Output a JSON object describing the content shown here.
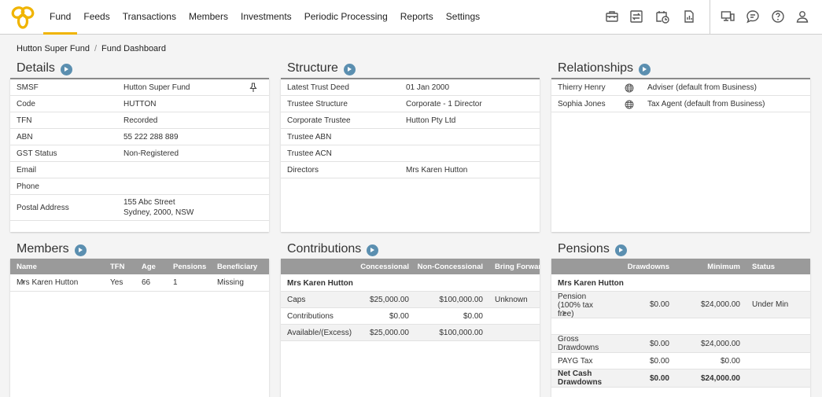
{
  "nav": {
    "items": [
      "Fund",
      "Feeds",
      "Transactions",
      "Members",
      "Investments",
      "Periodic Processing",
      "Reports",
      "Settings"
    ],
    "active": "Fund"
  },
  "icons": [
    "briefcase-icon",
    "transfer-icon",
    "calendar-clock-icon",
    "report-doc-icon",
    "devices-icon",
    "chat-icon",
    "help-icon",
    "user-icon"
  ],
  "colors": {
    "accent": "#f0b400",
    "go_button": "#5b8fb0",
    "table_header": "#9a9a9a"
  },
  "breadcrumb": {
    "root": "Hutton Super Fund",
    "sep": "/",
    "current": "Fund Dashboard"
  },
  "details": {
    "title": "Details",
    "rows": [
      {
        "k": "SMSF",
        "v": "Hutton Super Fund"
      },
      {
        "k": "Code",
        "v": "HUTTON"
      },
      {
        "k": "TFN",
        "v": "Recorded"
      },
      {
        "k": "ABN",
        "v": "55 222 288 889"
      },
      {
        "k": "GST Status",
        "v": "Non-Registered"
      },
      {
        "k": "Email",
        "v": ""
      },
      {
        "k": "Phone",
        "v": ""
      }
    ],
    "postal": {
      "k": "Postal Address",
      "line1": "155 Abc Street",
      "line2": "Sydney, 2000, NSW"
    }
  },
  "structure": {
    "title": "Structure",
    "rows": [
      {
        "k": "Latest Trust Deed",
        "v": "01 Jan 2000"
      },
      {
        "k": "Trustee Structure",
        "v": "Corporate - 1 Director"
      },
      {
        "k": "Corporate Trustee",
        "v": "Hutton Pty Ltd"
      },
      {
        "k": "Trustee ABN",
        "v": ""
      },
      {
        "k": "Trustee ACN",
        "v": ""
      },
      {
        "k": "Directors",
        "v": "Mrs Karen Hutton"
      }
    ]
  },
  "relationships": {
    "title": "Relationships",
    "rows": [
      {
        "name": "Thierry Henry",
        "role": "Adviser (default from Business)"
      },
      {
        "name": "Sophia Jones",
        "role": "Tax Agent (default from Business)"
      }
    ]
  },
  "members": {
    "title": "Members",
    "headers": [
      "Name",
      "TFN",
      "Age",
      "Pensions",
      "Beneficiary"
    ],
    "rows": [
      {
        "name": "Mrs Karen Hutton",
        "tfn": "Yes",
        "age": "66",
        "pensions": "1",
        "beneficiary": "Missing"
      }
    ]
  },
  "contributions": {
    "title": "Contributions",
    "headers": [
      "Concessional",
      "Non-Concessional",
      "Bring Forward"
    ],
    "member": "Mrs Karen Hutton",
    "rows": [
      {
        "label": "Caps",
        "c": "$25,000.00",
        "nc": "$100,000.00",
        "bf": "Unknown"
      },
      {
        "label": "Contributions",
        "c": "$0.00",
        "nc": "$0.00",
        "bf": ""
      },
      {
        "label": "Available/(Excess)",
        "c": "$25,000.00",
        "nc": "$100,000.00",
        "bf": ""
      }
    ]
  },
  "pensions": {
    "title": "Pensions",
    "headers": [
      "Drawdowns",
      "Minimum",
      "Status"
    ],
    "member": "Mrs Karen Hutton",
    "pension_row": {
      "l1": "Pension",
      "l2": "(100% tax",
      "l3": "free)",
      "drawdowns": "$0.00",
      "minimum": "$24,000.00",
      "status": "Under Min"
    },
    "gross": {
      "l1": "Gross",
      "l2": "Drawdowns",
      "drawdowns": "$0.00",
      "minimum": "$24,000.00"
    },
    "payg": {
      "label": "PAYG Tax",
      "drawdowns": "$0.00",
      "minimum": "$0.00"
    },
    "net": {
      "l1": "Net Cash",
      "l2": "Drawdowns",
      "drawdowns": "$0.00",
      "minimum": "$24,000.00"
    }
  }
}
